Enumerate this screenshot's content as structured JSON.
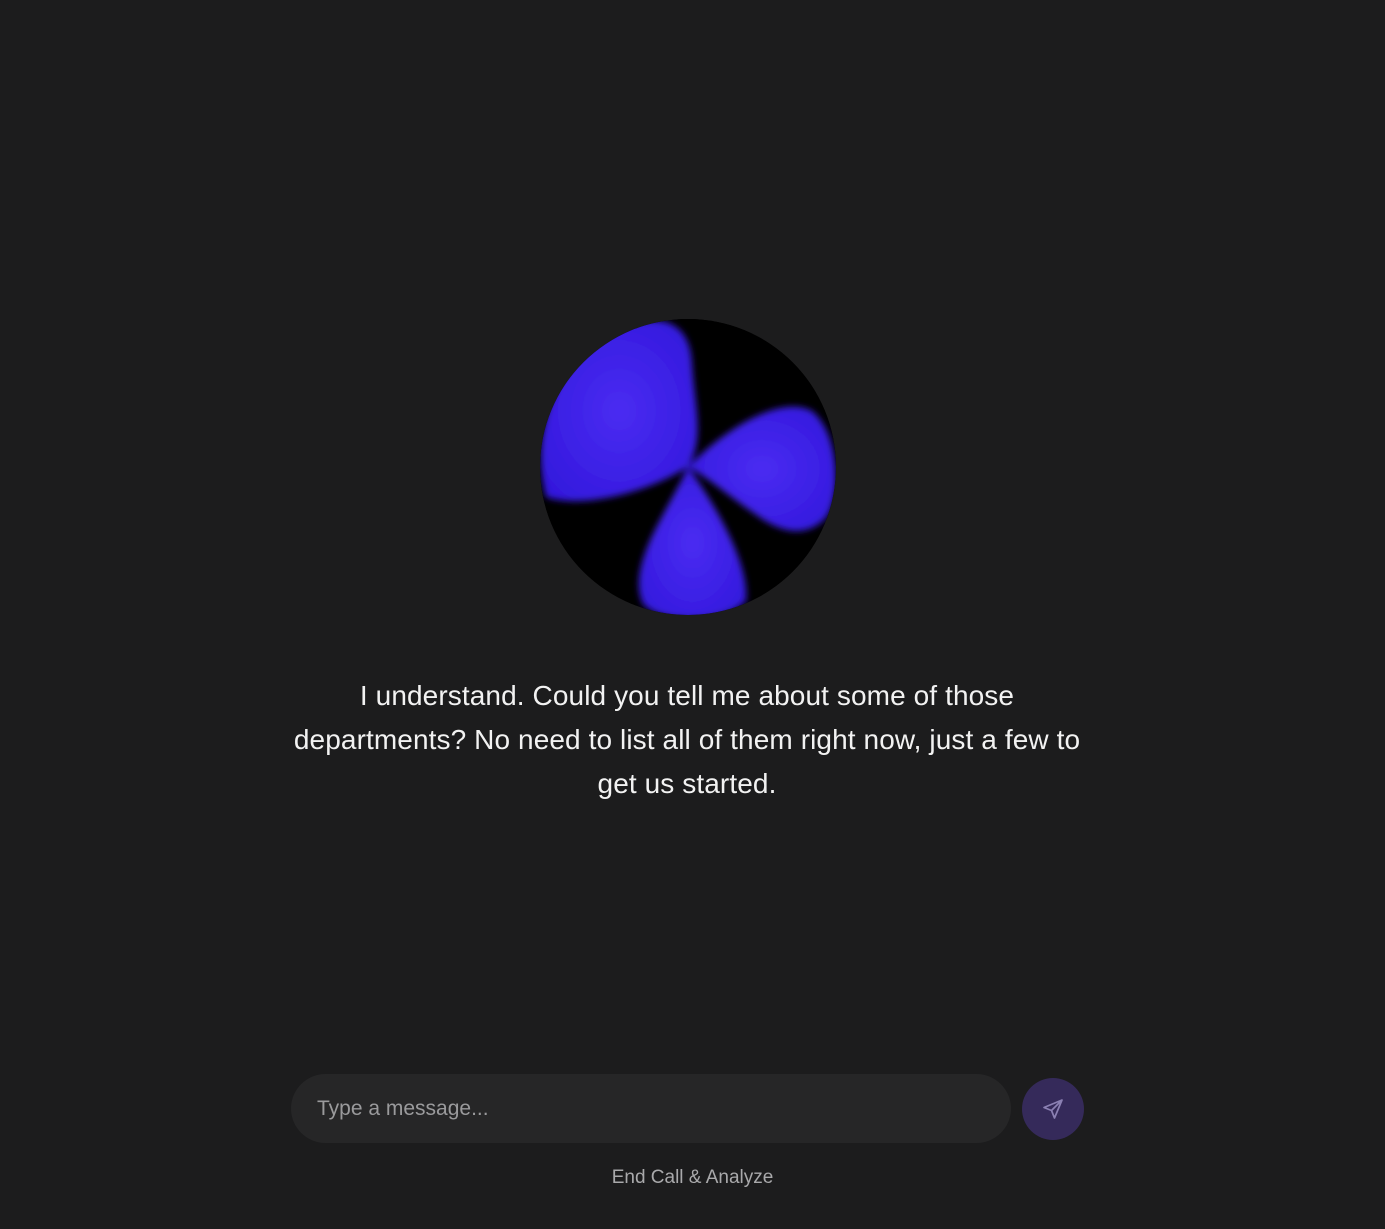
{
  "assistant": {
    "orb_colors": {
      "primary": "#3a1de6",
      "background": "#000000"
    },
    "message": "I understand. Could you tell me about some of those departments? No need to list all of them right now, just a few to get us started."
  },
  "composer": {
    "placeholder": "Type a message...",
    "value": "",
    "send_icon": "send-icon"
  },
  "footer": {
    "end_call_label": "End Call & Analyze"
  }
}
